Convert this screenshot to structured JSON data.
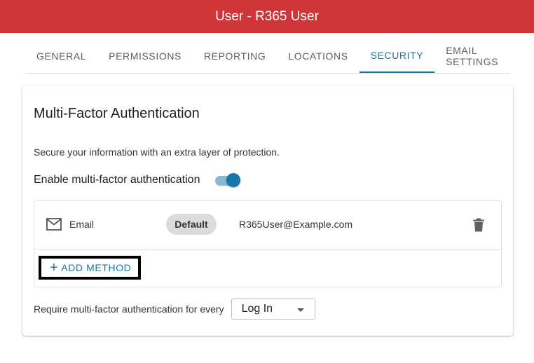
{
  "header": {
    "title": "User - R365 User",
    "color": "#d03539"
  },
  "tabs": [
    {
      "label": "GENERAL",
      "active": false
    },
    {
      "label": "PERMISSIONS",
      "active": false
    },
    {
      "label": "REPORTING",
      "active": false
    },
    {
      "label": "LOCATIONS",
      "active": false
    },
    {
      "label": "SECURITY",
      "active": true
    },
    {
      "label": "EMAIL SETTINGS",
      "active": false
    }
  ],
  "accent_color": "#1976a8",
  "mfa": {
    "title": "Multi-Factor Authentication",
    "description": "Secure your information with an extra layer of protection.",
    "enable_label": "Enable multi-factor authentication",
    "enabled": true,
    "methods": [
      {
        "icon": "mail-icon",
        "name": "Email",
        "badge": "Default",
        "value": "R365User@Example.com",
        "delete_icon": "trash-icon"
      }
    ],
    "add_method_label": "ADD METHOD",
    "require_label": "Require multi-factor authentication for every",
    "require_selected": "Log In"
  }
}
